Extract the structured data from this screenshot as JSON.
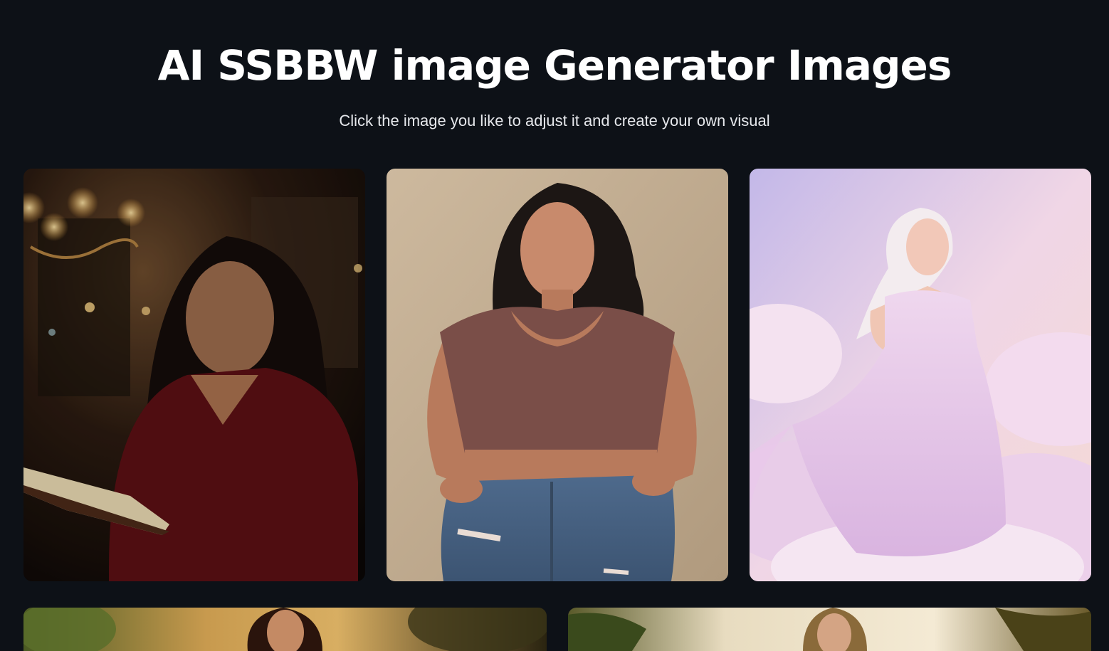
{
  "header": {
    "title": "AI SSBBW image Generator Images",
    "subtitle": "Click the image you like to adjust it and create your own visual"
  },
  "gallery": {
    "images": [
      {
        "label": "woman-reading-book-cafe",
        "dominant_color": "#2a1a12"
      },
      {
        "label": "woman-crop-top-jeans-illustration",
        "dominant_color": "#c2ad92"
      },
      {
        "label": "woman-white-gown-clouds",
        "dominant_color": "#e9d5ec"
      },
      {
        "label": "woman-outdoor-sunset-foliage",
        "dominant_color": "#a57a3a"
      },
      {
        "label": "woman-beach-palm-trees",
        "dominant_color": "#d8c9a0"
      }
    ]
  },
  "colors": {
    "background": "#0d1117",
    "title": "#ffffff",
    "subtitle": "#e6e8ec"
  }
}
